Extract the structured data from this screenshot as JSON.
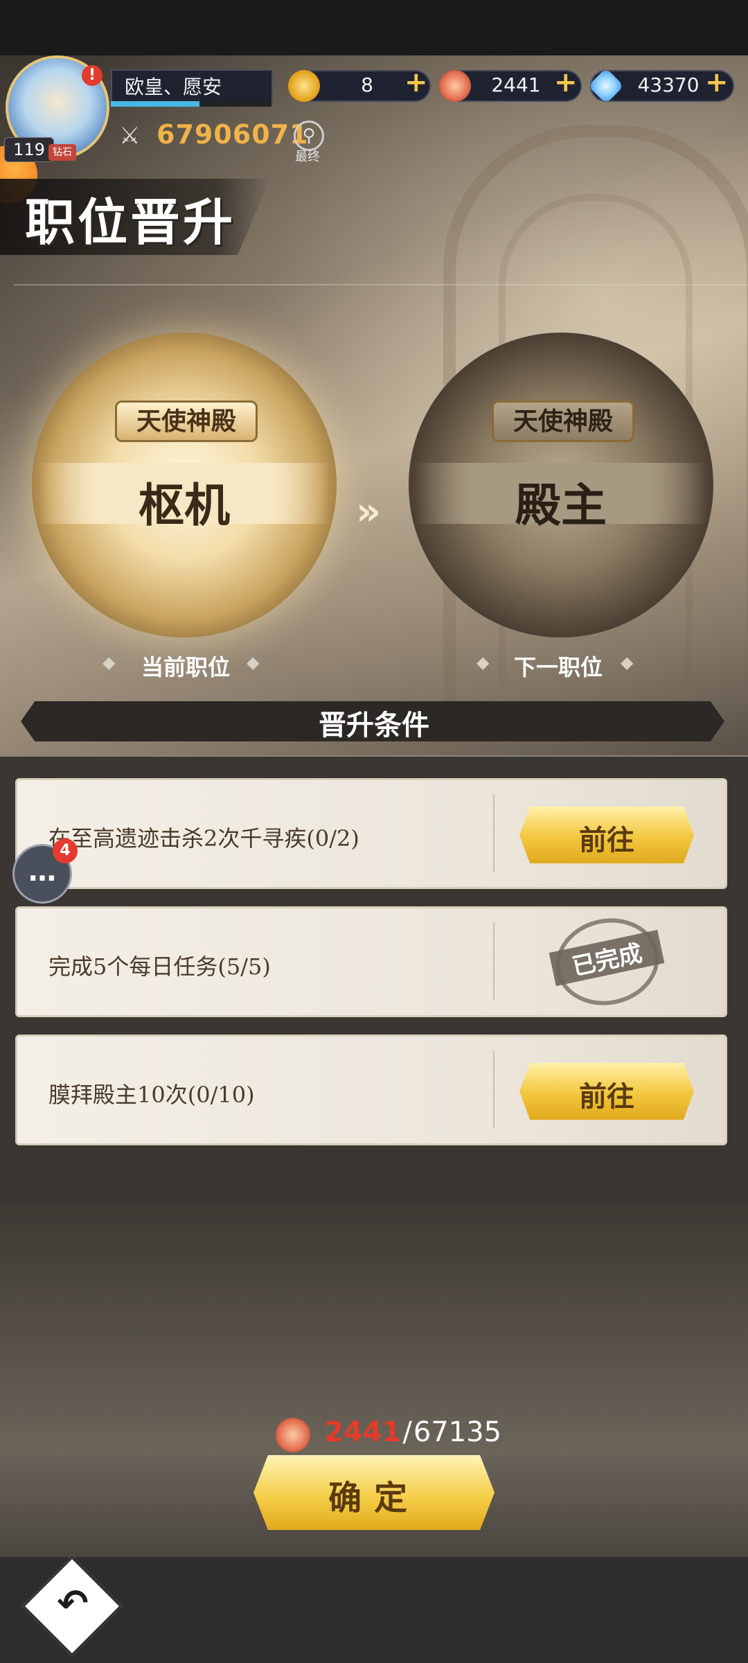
{
  "player": {
    "name": "欧皇、愿安",
    "level": "119",
    "avatar_tag": "钻石",
    "alert": "!",
    "xp_fraction": 0.55,
    "power": "67906071",
    "search_label": "最终"
  },
  "resources": [
    {
      "icon": "gold-coin-icon",
      "value": "8"
    },
    {
      "icon": "red-coin-icon",
      "value": "2441"
    },
    {
      "icon": "diamond-icon",
      "value": "43370"
    }
  ],
  "page_title": "职位晋升",
  "current": {
    "hall": "天使神殿",
    "rank": "枢机",
    "caption": "当前职位"
  },
  "next": {
    "hall": "天使神殿",
    "rank": "殿主",
    "caption": "下一职位"
  },
  "conditions_title": "晋升条件",
  "conditions": [
    {
      "text": "在至高遗迹击杀2次千寻疾(0/2)",
      "action": "前往",
      "status": "pending"
    },
    {
      "text": "完成5个每日任务(5/5)",
      "action": "已完成",
      "status": "done"
    },
    {
      "text": "膜拜殿主10次(0/10)",
      "action": "前往",
      "status": "pending"
    }
  ],
  "chat": {
    "badge": "4"
  },
  "cost": {
    "have": "2441",
    "separator": "/",
    "need": "67135"
  },
  "confirm_label": "确定",
  "colors": {
    "accent_gold": "#f2c63c",
    "cost_insufficient": "#e23b2a"
  }
}
